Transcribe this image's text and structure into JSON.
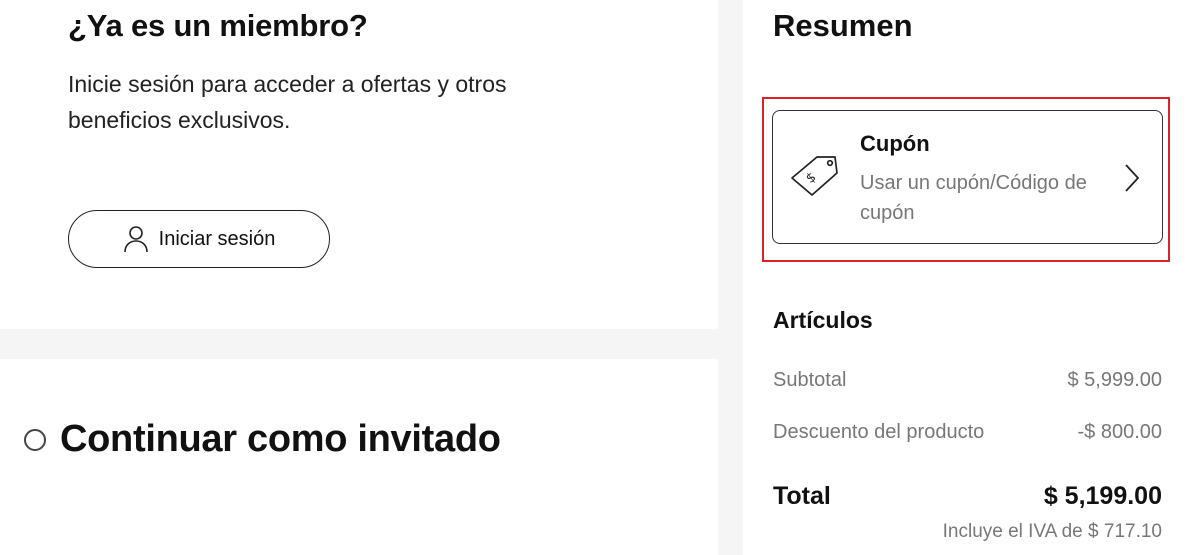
{
  "member": {
    "title": "¿Ya es un miembro?",
    "description": "Inicie sesión para acceder a ofertas y otros beneficios exclusivos.",
    "login_label": "Iniciar sesión"
  },
  "guest": {
    "label": "Continuar como invitado",
    "selected": false
  },
  "summary": {
    "title": "Resumen",
    "coupon": {
      "title": "Cupón",
      "description": "Usar un cupón/Código de cupón",
      "icon": "tag-icon"
    },
    "items_title": "Artículos",
    "subtotal_label": "Subtotal",
    "subtotal_value": "$ 5,999.00",
    "discount_label": "Descuento del producto",
    "discount_value": "-$ 800.00",
    "total_label": "Total",
    "total_value": "$ 5,199.00",
    "tax_note": "Incluye el IVA de $ 717.10"
  },
  "colors": {
    "highlight": "#d8232a",
    "background": "#f5f5f5",
    "muted_text": "#777777"
  }
}
